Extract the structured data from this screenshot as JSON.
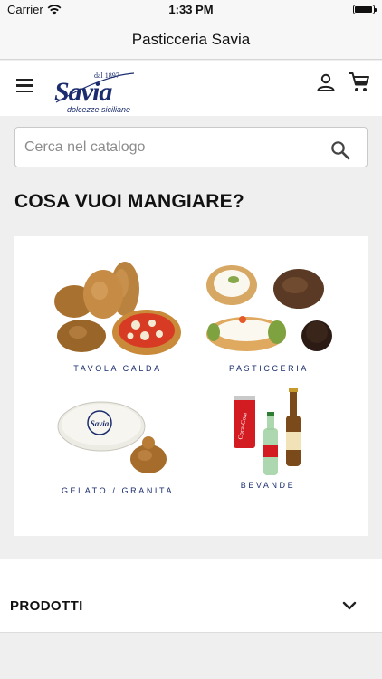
{
  "status_bar": {
    "carrier": "Carrier",
    "time": "1:33 PM",
    "battery_level": 0.95
  },
  "nav": {
    "title": "Pasticceria Savia"
  },
  "header": {
    "logo": {
      "since": "dal 1897",
      "name": "Savia",
      "tagline": "dolcezze siciliane"
    },
    "icons": [
      "menu-icon",
      "account-icon",
      "cart-icon"
    ]
  },
  "search": {
    "placeholder": "Cerca nel catalogo",
    "value": ""
  },
  "page": {
    "title": "COSA VUOI MANGIARE?"
  },
  "categories": [
    {
      "label": "TAVOLA CALDA"
    },
    {
      "label": "PASTICCERIA"
    },
    {
      "label": "GELATO / GRANITA"
    },
    {
      "label": "BEVANDE"
    }
  ],
  "accordion": {
    "label": "PRODOTTI"
  },
  "colors": {
    "brand_blue": "#1b2d6e",
    "page_bg": "#efefef",
    "coca_cola_red": "#d31b22"
  }
}
